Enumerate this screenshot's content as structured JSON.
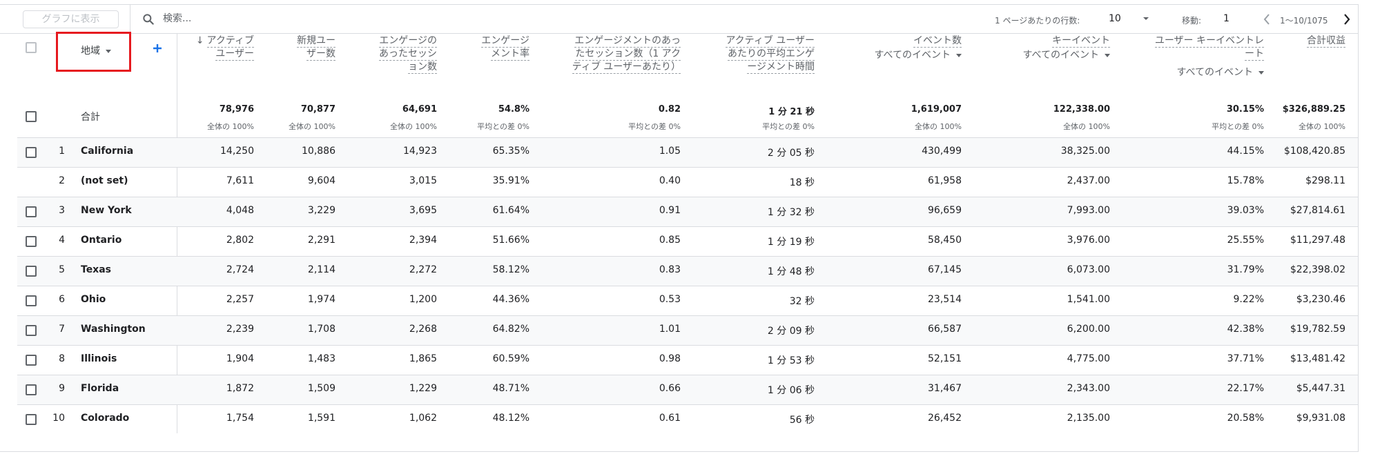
{
  "toolbar": {
    "chart_button": "グラフに表示",
    "search_placeholder": "検索...",
    "rows_per_page_label": "1 ページあたりの行数:",
    "rows_per_page_value": "10",
    "goto_label": "移動:",
    "goto_value": "1",
    "range_text": "1〜10/1075"
  },
  "dimension": {
    "label": "地域"
  },
  "columns": [
    {
      "title_lines": [
        "アクティブ",
        "ユーザー"
      ],
      "sort_arrow": "↓"
    },
    {
      "title_lines": [
        "新規ユー",
        "ザー数"
      ]
    },
    {
      "title_lines": [
        "エンゲージの",
        "あったセッシ",
        "ョン数"
      ]
    },
    {
      "title_lines": [
        "エンゲージ",
        "メント率"
      ]
    },
    {
      "title_lines": [
        "エンゲージメントのあっ",
        "たセッション数（1 アク",
        "ティブ ユーザーあたり）"
      ]
    },
    {
      "title_lines": [
        "アクティブ ユーザー",
        "あたりの平均エンゲ",
        "ージメント時間"
      ]
    },
    {
      "title_lines": [
        "イベント数"
      ],
      "sub": "すべてのイベント"
    },
    {
      "title_lines": [
        "キーイベント"
      ],
      "sub": "すべてのイベント"
    },
    {
      "title_lines": [
        "ユーザー キーイベントレ",
        "ート"
      ],
      "sub": "すべてのイベント"
    },
    {
      "title_lines": [
        "合計収益"
      ]
    }
  ],
  "totals": {
    "label": "合計",
    "values": [
      "78,976",
      "70,877",
      "64,691",
      "54.8%",
      "0.82",
      "1 分 21 秒",
      "1,619,007",
      "122,338.00",
      "30.15%",
      "$326,889.25"
    ],
    "subs": [
      "全体の 100%",
      "全体の 100%",
      "全体の 100%",
      "平均との差 0%",
      "平均との差 0%",
      "平均との差 0%",
      "全体の 100%",
      "全体の 100%",
      "平均との差 0%",
      "全体の 100%"
    ]
  },
  "rows": [
    {
      "rank": "1",
      "name": "California",
      "checkbox": true,
      "values": [
        "14,250",
        "10,886",
        "14,923",
        "65.35%",
        "1.05",
        "2 分 05 秒",
        "430,499",
        "38,325.00",
        "44.15%",
        "$108,420.85"
      ]
    },
    {
      "rank": "2",
      "name": "(not set)",
      "checkbox": false,
      "values": [
        "7,611",
        "9,604",
        "3,015",
        "35.91%",
        "0.40",
        "18 秒",
        "61,958",
        "2,437.00",
        "15.78%",
        "$298.11"
      ]
    },
    {
      "rank": "3",
      "name": "New York",
      "checkbox": true,
      "values": [
        "4,048",
        "3,229",
        "3,695",
        "61.64%",
        "0.91",
        "1 分 32 秒",
        "96,659",
        "7,993.00",
        "39.03%",
        "$27,814.61"
      ]
    },
    {
      "rank": "4",
      "name": "Ontario",
      "checkbox": true,
      "values": [
        "2,802",
        "2,291",
        "2,394",
        "51.66%",
        "0.85",
        "1 分 19 秒",
        "58,450",
        "3,976.00",
        "25.55%",
        "$11,297.48"
      ]
    },
    {
      "rank": "5",
      "name": "Texas",
      "checkbox": true,
      "values": [
        "2,724",
        "2,114",
        "2,272",
        "58.12%",
        "0.83",
        "1 分 48 秒",
        "67,145",
        "6,073.00",
        "31.79%",
        "$22,398.02"
      ]
    },
    {
      "rank": "6",
      "name": "Ohio",
      "checkbox": true,
      "values": [
        "2,257",
        "1,974",
        "1,200",
        "44.36%",
        "0.53",
        "32 秒",
        "23,514",
        "1,541.00",
        "9.22%",
        "$3,230.46"
      ]
    },
    {
      "rank": "7",
      "name": "Washington",
      "checkbox": true,
      "values": [
        "2,239",
        "1,708",
        "2,268",
        "64.82%",
        "1.01",
        "2 分 09 秒",
        "66,587",
        "6,200.00",
        "42.38%",
        "$19,782.59"
      ]
    },
    {
      "rank": "8",
      "name": "Illinois",
      "checkbox": true,
      "values": [
        "1,904",
        "1,483",
        "1,865",
        "60.59%",
        "0.98",
        "1 分 53 秒",
        "52,151",
        "4,775.00",
        "37.71%",
        "$13,481.42"
      ]
    },
    {
      "rank": "9",
      "name": "Florida",
      "checkbox": true,
      "values": [
        "1,872",
        "1,509",
        "1,229",
        "48.71%",
        "0.66",
        "1 分 06 秒",
        "31,467",
        "2,343.00",
        "22.17%",
        "$5,447.31"
      ]
    },
    {
      "rank": "10",
      "name": "Colorado",
      "checkbox": true,
      "values": [
        "1,754",
        "1,591",
        "1,062",
        "48.12%",
        "0.61",
        "56 秒",
        "26,452",
        "2,135.00",
        "20.58%",
        "$9,931.08"
      ]
    }
  ],
  "colors": {
    "highlight": "#e6191f",
    "accent": "#1a73e8",
    "border": "#dadce0",
    "muted": "#5f6368"
  }
}
